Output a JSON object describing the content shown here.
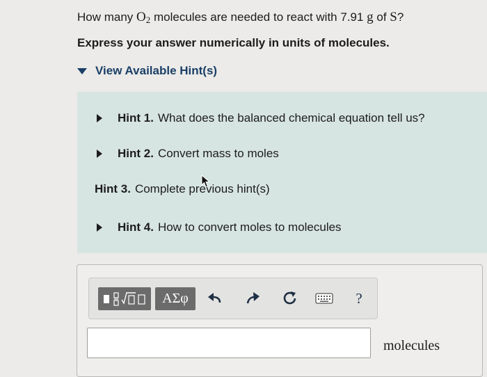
{
  "question": {
    "prefix": "How many ",
    "molecule_symbol": "O",
    "molecule_subscript": "2",
    "middle": " molecules are needed to react with 7.91 ",
    "mass_unit": "g",
    "connector": " of ",
    "element": "S",
    "suffix": "?"
  },
  "instruction": "Express your answer numerically in units of molecules.",
  "hints": {
    "toggle_label": "View Available Hint(s)",
    "items": [
      {
        "number": "Hint 1.",
        "text": "What does the balanced chemical equation tell us?",
        "expandable": true
      },
      {
        "number": "Hint 2.",
        "text": "Convert mass to moles",
        "expandable": true
      },
      {
        "number": "Hint 3.",
        "text": "Complete previous hint(s)",
        "expandable": false
      },
      {
        "number": "Hint 4.",
        "text": "How to convert moles to molecules",
        "expandable": true
      }
    ]
  },
  "toolbar": {
    "templates_icon": "templates-icon",
    "symbols_label": "ΑΣφ",
    "undo_icon": "undo-icon",
    "redo_icon": "redo-icon",
    "reset_icon": "reset-icon",
    "keyboard_icon": "keyboard-icon",
    "help_label": "?"
  },
  "answer": {
    "value": "",
    "units": "molecules"
  },
  "colors": {
    "page_bg": "#ecebe9",
    "hint_panel_bg": "#d7e5e2",
    "link": "#1a3f66",
    "toolbar_button": "#6b6b6b"
  }
}
